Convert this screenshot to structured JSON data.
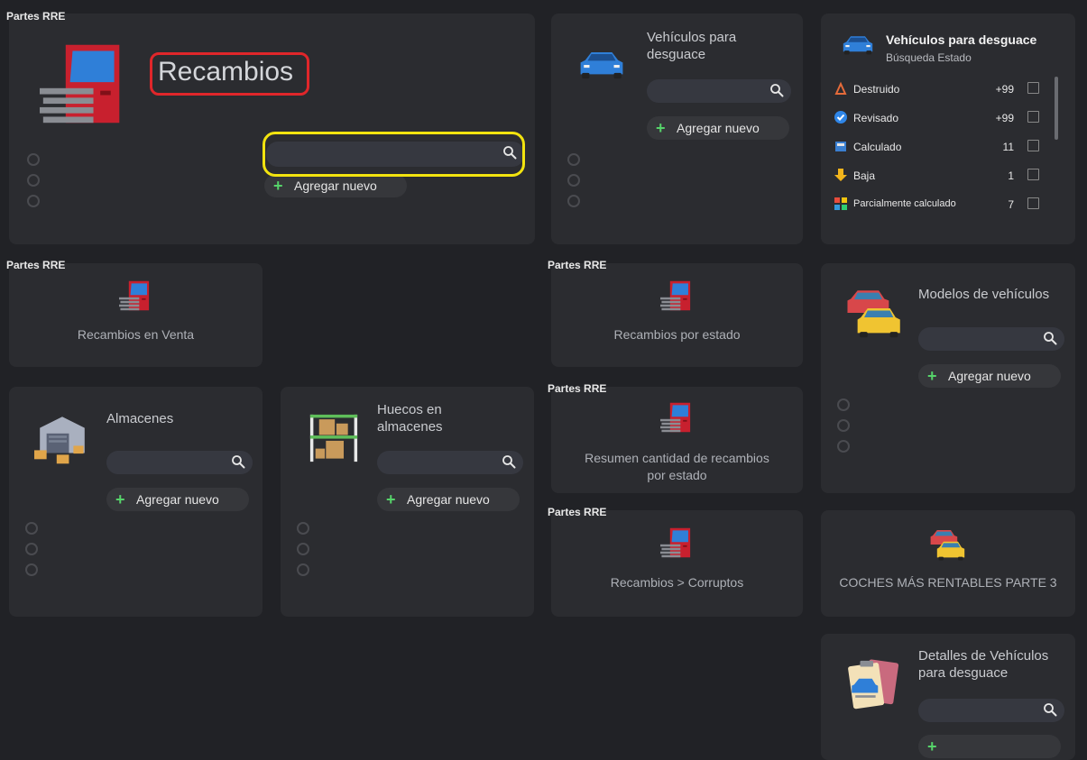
{
  "group_label": "Partes RRE",
  "recambios": {
    "title": "Recambios",
    "add": "Agregar nuevo"
  },
  "vehiculos_desguace": {
    "title_line1": "Vehículos para",
    "title_line2": "desguace",
    "add": "Agregar nuevo"
  },
  "stats": {
    "title": "Vehículos para desguace",
    "subtitle": "Búsqueda Estado",
    "items": [
      {
        "label": "Destruido",
        "value": "+99"
      },
      {
        "label": "Revisado",
        "value": "+99"
      },
      {
        "label": "Calculado",
        "value": "11"
      },
      {
        "label": "Baja",
        "value": "1"
      },
      {
        "label": "Parcialmente calculado",
        "value": "7"
      }
    ]
  },
  "recambios_venta": {
    "title": "Recambios en Venta"
  },
  "recambios_estado": {
    "title": "Recambios por estado"
  },
  "modelos": {
    "title": "Modelos de vehículos",
    "add": "Agregar nuevo"
  },
  "almacenes": {
    "title": "Almacenes",
    "add": "Agregar nuevo"
  },
  "huecos": {
    "title_line1": "Huecos en",
    "title_line2": "almacenes",
    "add": "Agregar nuevo"
  },
  "resumen": {
    "title_line1": "Resumen cantidad de recambios",
    "title_line2": "por estado"
  },
  "corruptos": {
    "title": "Recambios > Corruptos"
  },
  "rentables": {
    "title": "COCHES MÁS RENTABLES PARTE 3"
  },
  "detalles": {
    "title_line1": "Detalles de Vehículos",
    "title_line2": "para desguace"
  },
  "colors": {
    "accent_green": "#56d36a",
    "car_red": "#c8202e",
    "car_blue": "#2f7fd8",
    "highlight_red": "#e0262a",
    "highlight_yellow": "#f2e30f"
  }
}
